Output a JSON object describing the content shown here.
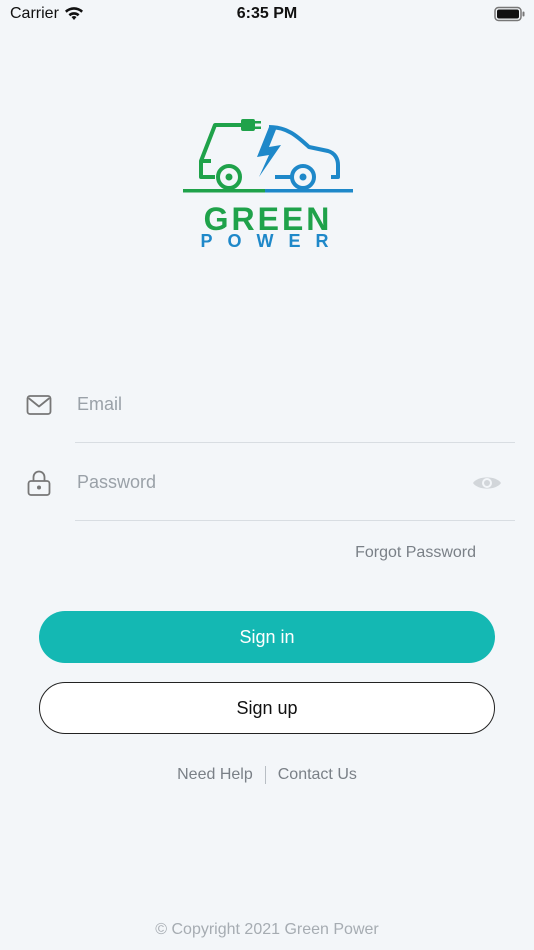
{
  "status_bar": {
    "carrier": "Carrier",
    "time": "6:35 PM"
  },
  "logo": {
    "line1": "GREEN",
    "line2": "POWER",
    "colors": {
      "green": "#1fa24a",
      "blue": "#1e88c9"
    }
  },
  "form": {
    "email": {
      "placeholder": "Email",
      "value": "",
      "icon": "envelope-icon"
    },
    "password": {
      "placeholder": "Password",
      "value": "",
      "icon": "lock-icon",
      "toggle_icon": "eye-icon"
    },
    "forgot_label": "Forgot Password"
  },
  "buttons": {
    "signin_label": "Sign in",
    "signup_label": "Sign up",
    "accent": "#14b8b3"
  },
  "links": {
    "help": "Need Help",
    "contact": "Contact Us"
  },
  "footer": {
    "copyright": "© Copyright 2021 Green Power"
  }
}
